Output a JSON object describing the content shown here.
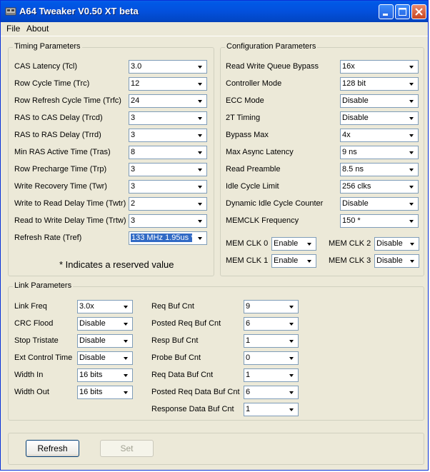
{
  "window": {
    "title": "A64 Tweaker V0.50 XT beta"
  },
  "menu": {
    "file": "File",
    "about": "About"
  },
  "timing": {
    "title": "Timing Parameters",
    "rows": [
      {
        "label": "CAS Latency (Tcl)",
        "value": "3.0"
      },
      {
        "label": "Row Cycle Time (Trc)",
        "value": "12"
      },
      {
        "label": "Row Refresh Cycle Time (Trfc)",
        "value": "24"
      },
      {
        "label": "RAS to CAS Delay (Trcd)",
        "value": "3"
      },
      {
        "label": "RAS to RAS Delay (Trrd)",
        "value": "3"
      },
      {
        "label": "Min RAS Active Time (Tras)",
        "value": "8"
      },
      {
        "label": "Row Precharge Time (Trp)",
        "value": "3"
      },
      {
        "label": "Write Recovery Time (Twr)",
        "value": "3"
      },
      {
        "label": "Write to Read Delay Time (Twtr)",
        "value": "2"
      },
      {
        "label": "Read to Write Delay Time (Trtw)",
        "value": "3"
      },
      {
        "label": "Refresh Rate (Tref)",
        "value": "133 MHz 1.95us *"
      }
    ],
    "note": "* Indicates a reserved value"
  },
  "config": {
    "title": "Configuration Parameters",
    "rows": [
      {
        "label": "Read Write Queue Bypass",
        "value": "16x"
      },
      {
        "label": "Controller Mode",
        "value": "128 bit"
      },
      {
        "label": "ECC Mode",
        "value": "Disable"
      },
      {
        "label": "2T Timing",
        "value": "Disable"
      },
      {
        "label": "Bypass Max",
        "value": "4x"
      },
      {
        "label": "Max Async Latency",
        "value": "9 ns"
      },
      {
        "label": "Read Preamble",
        "value": "8.5 ns"
      },
      {
        "label": "Idle Cycle Limit",
        "value": "256 clks"
      },
      {
        "label": "Dynamic Idle Cycle Counter",
        "value": "Disable"
      },
      {
        "label": "MEMCLK Frequency",
        "value": "150 *"
      }
    ],
    "memclk": [
      {
        "label": "MEM CLK 0",
        "value": "Enable"
      },
      {
        "label": "MEM CLK 2",
        "value": "Disable"
      },
      {
        "label": "MEM CLK 1",
        "value": "Enable"
      },
      {
        "label": "MEM CLK 3",
        "value": "Disable"
      }
    ]
  },
  "link": {
    "title": "Link Parameters",
    "left": [
      {
        "label": "Link Freq",
        "value": "3.0x"
      },
      {
        "label": "CRC Flood",
        "value": "Disable"
      },
      {
        "label": "Stop Tristate",
        "value": "Disable"
      },
      {
        "label": "Ext Control Time",
        "value": "Disable"
      },
      {
        "label": "Width In",
        "value": "16 bits"
      },
      {
        "label": "Width Out",
        "value": "16 bits"
      }
    ],
    "right": [
      {
        "label": "Req Buf Cnt",
        "value": "9"
      },
      {
        "label": "Posted Req Buf Cnt",
        "value": "6"
      },
      {
        "label": "Resp Buf Cnt",
        "value": "1"
      },
      {
        "label": "Probe Buf Cnt",
        "value": "0"
      },
      {
        "label": "Req Data Buf Cnt",
        "value": "1"
      },
      {
        "label": "Posted Req Data Buf Cnt",
        "value": "6"
      },
      {
        "label": "Response Data Buf Cnt",
        "value": "1"
      }
    ]
  },
  "buttons": {
    "refresh": "Refresh",
    "set": "Set"
  }
}
